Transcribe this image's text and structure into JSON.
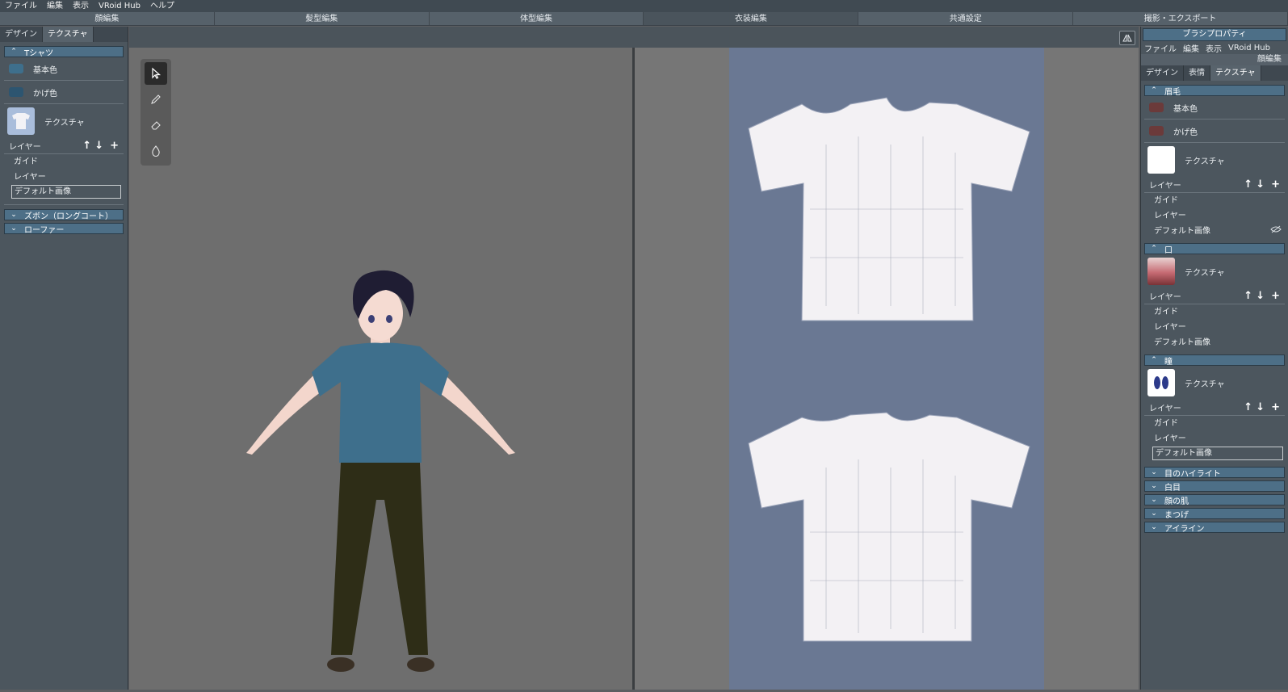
{
  "menubar": {
    "items": [
      "ファイル",
      "編集",
      "表示",
      "VRoid Hub",
      "ヘルプ"
    ]
  },
  "modes": [
    "顔編集",
    "髪型編集",
    "体型編集",
    "衣装編集",
    "共通設定",
    "撮影・エクスポート"
  ],
  "left": {
    "tabs": [
      "デザイン",
      "テクスチャ"
    ],
    "section1": {
      "title": "Tシャツ",
      "base": "基本色",
      "shade": "かげ色",
      "texture": "テクスチャ",
      "layers_label": "レイヤー",
      "layers": [
        "ガイド",
        "レイヤー",
        "デフォルト画像"
      ]
    },
    "section2": "ズボン（ロングコート）",
    "section3": "ローファー"
  },
  "colors": {
    "shirt": "#3e6f8c",
    "shade": "#2d5570",
    "brow": "#6b3a3a",
    "accent": "#4d6f87"
  },
  "right": {
    "title": "ブラシプロパティ",
    "menu": [
      "ファイル",
      "編集",
      "表示",
      "VRoid Hub"
    ],
    "mode": "顔編集",
    "tabs": [
      "デザイン",
      "表情",
      "テクスチャ"
    ],
    "brow": {
      "title": "眉毛",
      "base": "基本色",
      "shade": "かげ色",
      "texture": "テクスチャ",
      "layers_label": "レイヤー",
      "layers": [
        "ガイド",
        "レイヤー",
        "デフォルト画像"
      ]
    },
    "mouth": {
      "title": "口",
      "texture": "テクスチャ",
      "layers_label": "レイヤー",
      "layers": [
        "ガイド",
        "レイヤー",
        "デフォルト画像"
      ]
    },
    "eye": {
      "title": "瞳",
      "texture": "テクスチャ",
      "layers_label": "レイヤー",
      "layers": [
        "ガイド",
        "レイヤー",
        "デフォルト画像"
      ]
    },
    "collapsed": [
      "目のハイライト",
      "白目",
      "顔の肌",
      "まつげ",
      "アイライン"
    ]
  },
  "icons": [
    "cursor-icon",
    "pen-icon",
    "eraser-icon",
    "dropper-icon",
    "mirror-icon",
    "eye-hidden-icon"
  ]
}
